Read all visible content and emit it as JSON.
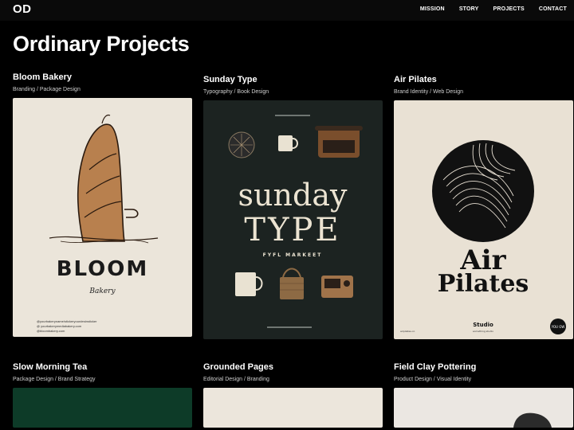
{
  "header": {
    "logo": "OD",
    "nav": [
      "MISSION",
      "STORY",
      "PROJECTS",
      "CONTACT"
    ]
  },
  "page_title": "Ordinary Projects",
  "projects": [
    {
      "title": "Bloom Bakery",
      "subtitle": "Branding / Package Design",
      "poster": {
        "wordmark": "BLOOM",
        "script": "Bakery",
        "footer": [
          "@yourbakeryname/stickeryourdesinsticker",
          "@ yourbakerymediabakery.com",
          "@bloombakery.com"
        ]
      }
    },
    {
      "title": "Sunday Type",
      "subtitle": "Typography / Book Design",
      "poster": {
        "line1": "sunday",
        "line2": "TYPE",
        "tagline": "FYFL MARKEET"
      }
    },
    {
      "title": "Air Pilates",
      "subtitle": "Brand Identity / Web Design",
      "poster": {
        "line1": "Air",
        "line2": "Pilates",
        "studio": "Studio",
        "studio_sub": "something studio",
        "corner": "airpilates.co",
        "badge": "YOU OW"
      }
    },
    {
      "title": "Slow Morning Tea",
      "subtitle": "Package Design / Brand Strategy"
    },
    {
      "title": "Grounded Pages",
      "subtitle": "Editorial Design / Branding"
    },
    {
      "title": "Field Clay Pottering",
      "subtitle": "Product Design / Visual Identity"
    }
  ],
  "colors": {
    "background": "#000000",
    "topbar": "#0a0a0a",
    "bloom_bg": "#ebe5da",
    "sunday_bg": "#1c2321",
    "sunday_text": "#ece4d2",
    "air_bg": "#e9e1d4",
    "tea_bg": "#0d3b28",
    "pages_bg": "#ece6dc",
    "clay_bg": "#ebe7e2"
  }
}
